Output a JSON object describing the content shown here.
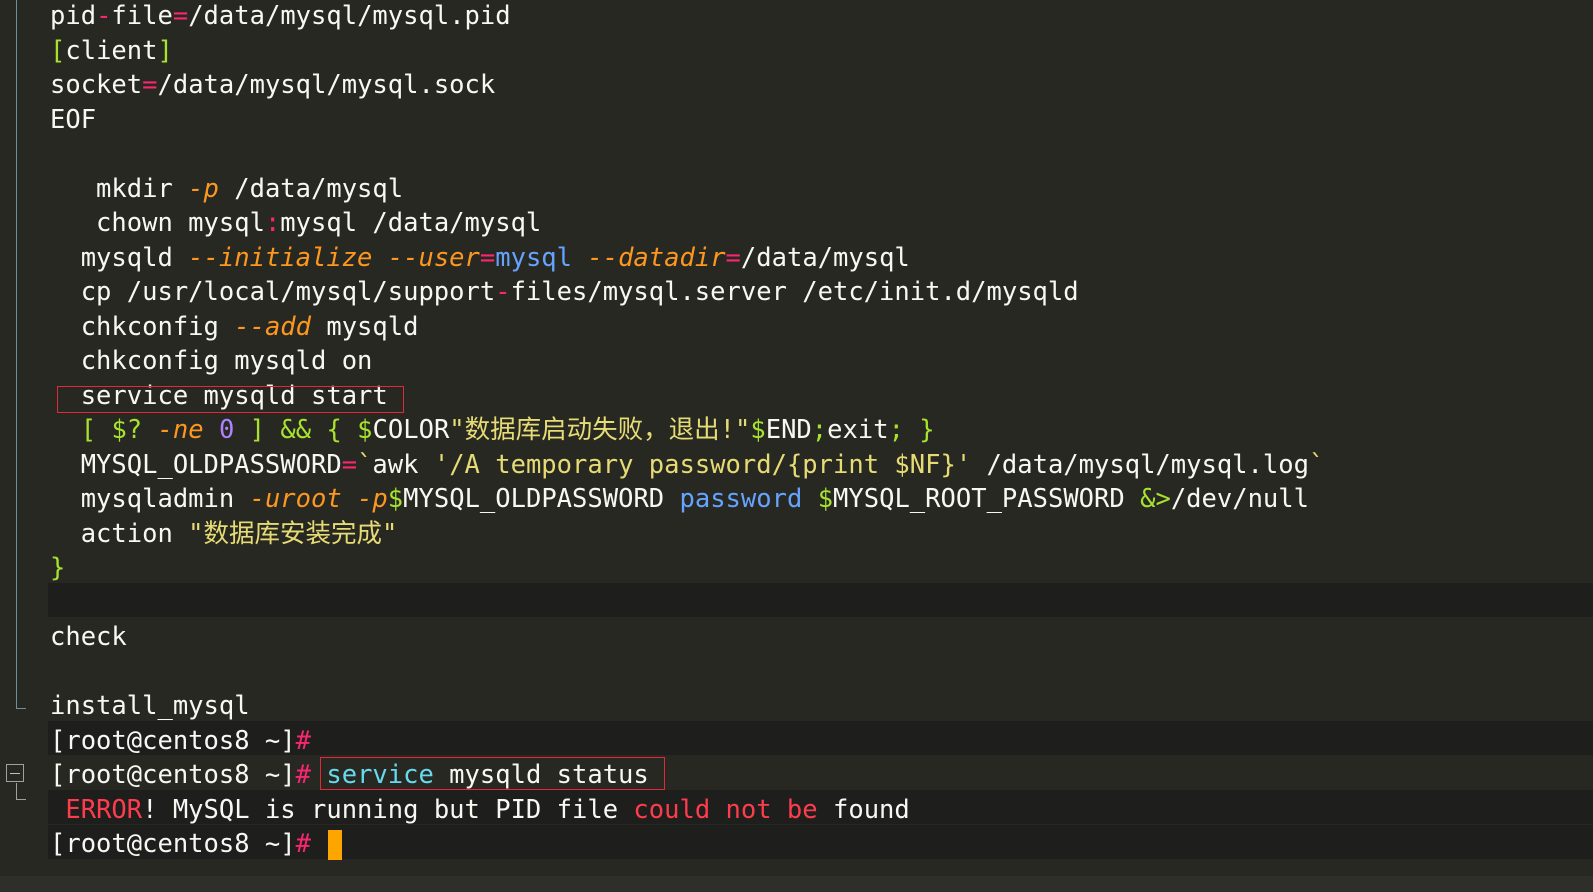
{
  "editor": {
    "lines": [
      [
        {
          "t": "pid",
          "c": "w"
        },
        {
          "t": "-",
          "c": "pk"
        },
        {
          "t": "file",
          "c": "w"
        },
        {
          "t": "=",
          "c": "pk"
        },
        {
          "t": "/data/mysql/mysql.pid",
          "c": "w"
        }
      ],
      [
        {
          "t": "[",
          "c": "g"
        },
        {
          "t": "client",
          "c": "w"
        },
        {
          "t": "]",
          "c": "g"
        }
      ],
      [
        {
          "t": "socket",
          "c": "w"
        },
        {
          "t": "=",
          "c": "pk"
        },
        {
          "t": "/data/mysql/mysql.sock",
          "c": "w"
        }
      ],
      [
        {
          "t": "EOF",
          "c": "w"
        }
      ],
      [],
      [
        {
          "t": "   mkdir ",
          "c": "w"
        },
        {
          "t": "-p",
          "c": "o"
        },
        {
          "t": " /data/mysql",
          "c": "w"
        }
      ],
      [
        {
          "t": "   chown mysql",
          "c": "w"
        },
        {
          "t": ":",
          "c": "pk"
        },
        {
          "t": "mysql /data/mysql",
          "c": "w"
        }
      ],
      [
        {
          "t": "  mysqld ",
          "c": "w"
        },
        {
          "t": "--initialize",
          "c": "o"
        },
        {
          "t": " ",
          "c": "w"
        },
        {
          "t": "--user",
          "c": "o"
        },
        {
          "t": "=",
          "c": "pk"
        },
        {
          "t": "mysql",
          "c": "b"
        },
        {
          "t": " ",
          "c": "w"
        },
        {
          "t": "--datadir",
          "c": "o"
        },
        {
          "t": "=",
          "c": "pk"
        },
        {
          "t": "/data/mysql",
          "c": "w"
        }
      ],
      [
        {
          "t": "  cp /usr/local/mysql/support",
          "c": "w"
        },
        {
          "t": "-",
          "c": "pk"
        },
        {
          "t": "files/mysql.server /etc/init.d/mysqld",
          "c": "w"
        }
      ],
      [
        {
          "t": "  chkconfig ",
          "c": "w"
        },
        {
          "t": "--add",
          "c": "o"
        },
        {
          "t": " mysqld",
          "c": "w"
        }
      ],
      [
        {
          "t": "  chkconfig mysqld on",
          "c": "w"
        }
      ],
      [
        {
          "t": "  service mysqld start",
          "c": "w"
        }
      ],
      [
        {
          "t": "  ",
          "c": "w"
        },
        {
          "t": "[",
          "c": "g"
        },
        {
          "t": " ",
          "c": "w"
        },
        {
          "t": "$?",
          "c": "g"
        },
        {
          "t": " ",
          "c": "w"
        },
        {
          "t": "-ne",
          "c": "o"
        },
        {
          "t": " ",
          "c": "w"
        },
        {
          "t": "0",
          "c": "p"
        },
        {
          "t": " ",
          "c": "w"
        },
        {
          "t": "]",
          "c": "g"
        },
        {
          "t": " ",
          "c": "w"
        },
        {
          "t": "&&",
          "c": "g"
        },
        {
          "t": " ",
          "c": "w"
        },
        {
          "t": "{",
          "c": "g"
        },
        {
          "t": " ",
          "c": "w"
        },
        {
          "t": "$",
          "c": "g"
        },
        {
          "t": "COLOR",
          "c": "w"
        },
        {
          "t": "\"数据库启动失败，退出!\"",
          "c": "y"
        },
        {
          "t": "$",
          "c": "g"
        },
        {
          "t": "END",
          "c": "w"
        },
        {
          "t": ";",
          "c": "g"
        },
        {
          "t": "exit",
          "c": "w"
        },
        {
          "t": ";",
          "c": "g"
        },
        {
          "t": " ",
          "c": "w"
        },
        {
          "t": "}",
          "c": "g"
        }
      ],
      [
        {
          "t": "  MYSQL_OLDPASSWORD",
          "c": "w"
        },
        {
          "t": "=",
          "c": "pk"
        },
        {
          "t": "`",
          "c": "y"
        },
        {
          "t": "awk ",
          "c": "w"
        },
        {
          "t": "'/A temporary password/{print $NF}'",
          "c": "y"
        },
        {
          "t": " /data/mysql/mysql.log",
          "c": "w"
        },
        {
          "t": "`",
          "c": "y"
        }
      ],
      [
        {
          "t": "  mysqladmin ",
          "c": "w"
        },
        {
          "t": "-uroot",
          "c": "o"
        },
        {
          "t": " ",
          "c": "w"
        },
        {
          "t": "-p",
          "c": "o"
        },
        {
          "t": "$",
          "c": "g"
        },
        {
          "t": "MYSQL_OLDPASSWORD ",
          "c": "w"
        },
        {
          "t": "password",
          "c": "b"
        },
        {
          "t": " ",
          "c": "w"
        },
        {
          "t": "$",
          "c": "g"
        },
        {
          "t": "MYSQL_ROOT_PASSWORD ",
          "c": "w"
        },
        {
          "t": "&>",
          "c": "g"
        },
        {
          "t": "/dev/null",
          "c": "w"
        }
      ],
      [
        {
          "t": "  action ",
          "c": "w"
        },
        {
          "t": "\"数据库安装完成\"",
          "c": "y"
        }
      ],
      [
        {
          "t": "}",
          "c": "g"
        }
      ],
      [],
      [
        {
          "t": "check",
          "c": "w"
        }
      ],
      [],
      [
        {
          "t": "install_mysql",
          "c": "w"
        }
      ]
    ]
  },
  "terminal": {
    "lines": [
      [
        {
          "t": "[root@centos8 ~]",
          "c": "w"
        },
        {
          "t": "#",
          "c": "pk"
        }
      ],
      [
        {
          "t": "[root@centos8 ~]",
          "c": "w"
        },
        {
          "t": "#",
          "c": "pk"
        },
        {
          "t": " ",
          "c": "w"
        },
        {
          "t": "service",
          "c": "c"
        },
        {
          "t": " mysqld status",
          "c": "w"
        }
      ],
      [
        {
          "t": " ",
          "c": "w"
        },
        {
          "t": "ERROR",
          "c": "r"
        },
        {
          "t": "! MySQL is running but PID file ",
          "c": "w"
        },
        {
          "t": "could not be",
          "c": "r"
        },
        {
          "t": " found",
          "c": "w"
        }
      ],
      [
        {
          "t": "[root@centos8 ~]",
          "c": "w"
        },
        {
          "t": "#",
          "c": "pk"
        },
        {
          "t": " ",
          "c": "w"
        }
      ]
    ]
  },
  "colors": {
    "background": "#272822",
    "highlight_box": "#e02a3a",
    "cursor": "#ffa500"
  }
}
